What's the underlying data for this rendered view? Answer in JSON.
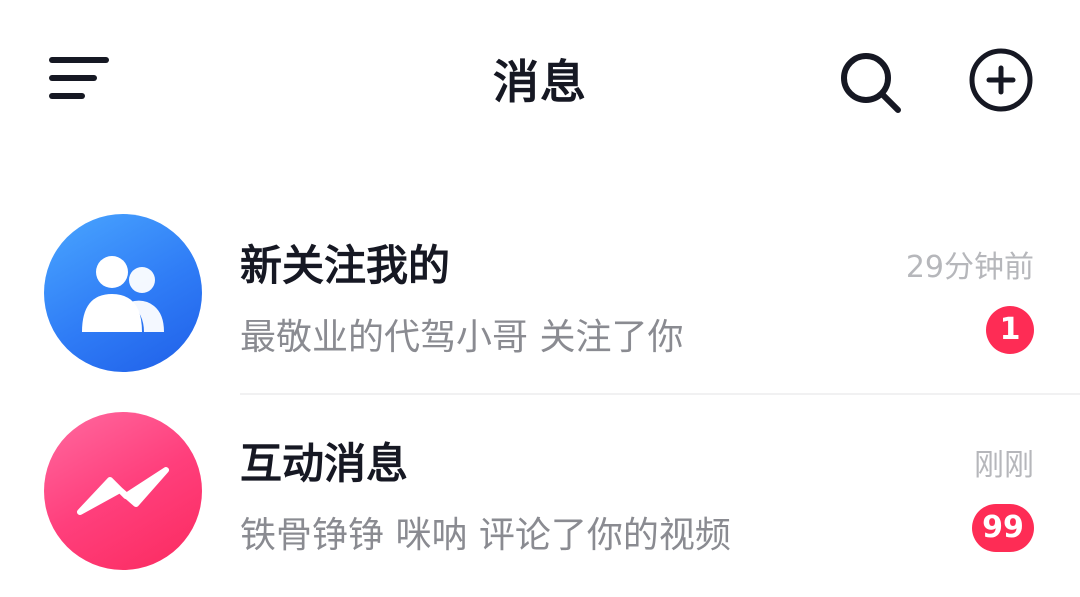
{
  "header": {
    "title": "消息",
    "menu_icon": "menu-lines-icon",
    "search_icon": "search-icon",
    "add_icon": "plus-circle-icon"
  },
  "messages": [
    {
      "title": "新关注我的",
      "subtitle": "最敬业的代驾小哥 关注了你",
      "time": "29分钟前",
      "badge": "1",
      "icon": "users-icon",
      "color": "#2f7cf6"
    },
    {
      "title": "互动消息",
      "subtitle": "铁骨铮铮 咪呐 评论了你的视频",
      "time": "刚刚",
      "badge": "99",
      "icon": "lightning-icon",
      "color": "#fe2c55"
    }
  ],
  "colors": {
    "title_text": "#161823",
    "subtitle_text": "#8a8b91",
    "time_text": "#b6b7bb",
    "badge": "#fe2c55"
  }
}
